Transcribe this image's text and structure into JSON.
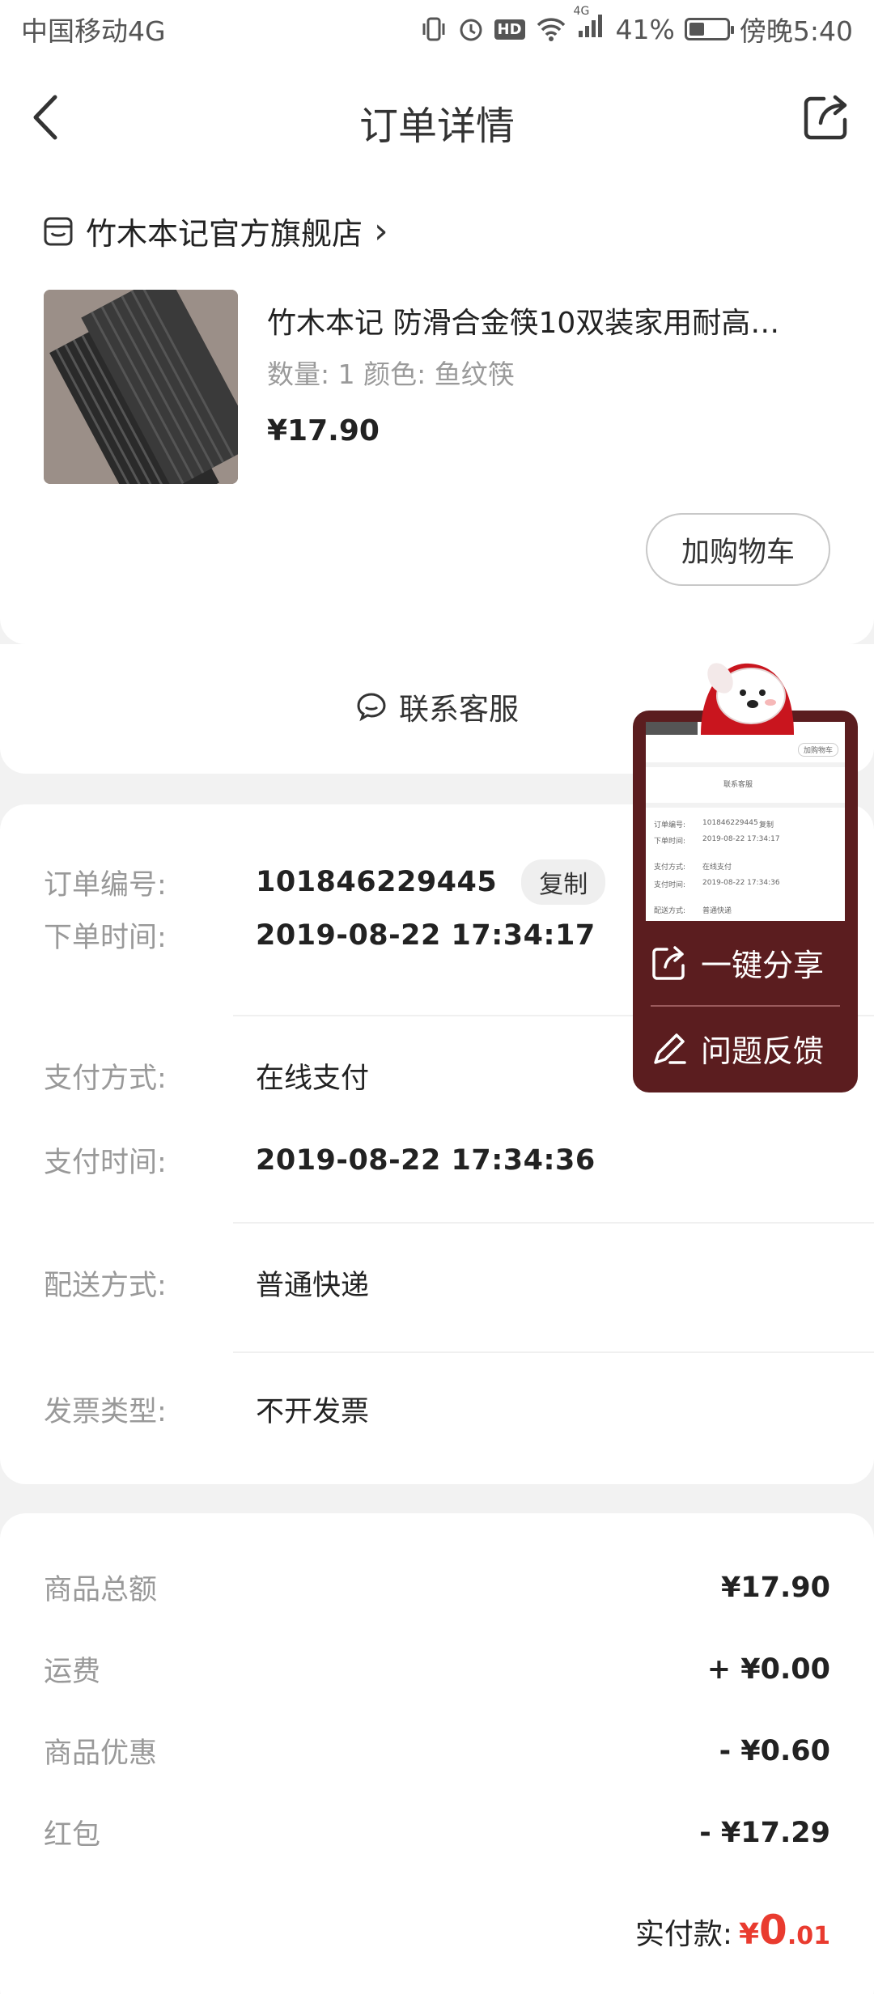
{
  "status_bar": {
    "carrier": "中国移动4G",
    "network_label": "4G",
    "hd_label": "HD",
    "battery": "41%",
    "battery_level": 0.41,
    "time": "傍晚5:40"
  },
  "header": {
    "title": "订单详情"
  },
  "shop": {
    "name": "竹木本记官方旗舰店",
    "arrow": "›"
  },
  "goods": {
    "name": "竹木本记 防滑合金筷10双装家用耐高…",
    "spec": "数量: 1   颜色: 鱼纹筷",
    "price": "¥17.90",
    "add_to_cart": "加购物车"
  },
  "service": {
    "label": "联系客服"
  },
  "order_info": {
    "rows": [
      {
        "label": "订单编号:",
        "value": "101846229445",
        "action": "复制"
      },
      {
        "label": "下单时间:",
        "value": "2019-08-22 17:34:17"
      },
      {
        "label": "支付方式:",
        "value": "在线支付"
      },
      {
        "label": "支付时间:",
        "value": "2019-08-22 17:34:36"
      },
      {
        "label": "配送方式:",
        "value": "普通快递"
      },
      {
        "label": "发票类型:",
        "value": "不开发票"
      }
    ]
  },
  "summary": {
    "rows": [
      {
        "label": "商品总额",
        "value": "¥17.90"
      },
      {
        "label": "运费",
        "value": "+ ¥0.00"
      },
      {
        "label": "商品优惠",
        "value": "- ¥0.60"
      },
      {
        "label": "红包",
        "value": "- ¥17.29"
      }
    ],
    "paid_label": "实付款:",
    "paid_currency": "¥",
    "paid_int": "0",
    "paid_dec": ".01"
  },
  "float_panel": {
    "share_label": "一键分享",
    "feedback_label": "问题反馈",
    "thumb": {
      "cart": "加购物车",
      "service": "联系客服",
      "rows": [
        {
          "label": "订单编号:",
          "value": "101846229445",
          "extra": "复制"
        },
        {
          "label": "下单时间:",
          "value": "2019-08-22 17:34:17"
        },
        {
          "label": "支付方式:",
          "value": "在线支付"
        },
        {
          "label": "支付时间:",
          "value": "2019-08-22 17:34:36"
        },
        {
          "label": "配送方式:",
          "value": "普通快递"
        }
      ]
    }
  },
  "colors": {
    "accent_red": "#e93b2f",
    "float_bg": "#5b1d1f"
  }
}
